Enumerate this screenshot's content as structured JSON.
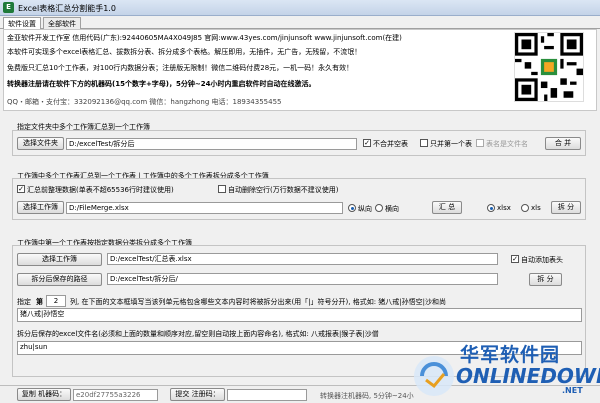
{
  "window": {
    "title": "Excel表格汇总分割能手1.0"
  },
  "tabs": [
    {
      "label": "软件设置",
      "active": true
    },
    {
      "label": "全部软件",
      "active": false
    }
  ],
  "info": {
    "line1": "金亚软件开发工作室 信用代码(广东):92440605MA4X049J85 官网:www.43yes.com/jinjunsoft  www.jinjunsoft.com(在建)",
    "line2": "本软件可实现多个excel表格汇总、拔数拆分表、拆分成多个表格。解压即用，无插件，无广告，无残留，不流氓！",
    "line3": "免费版只汇总10个工作表，对100行内数据分表；注册版无限制！微信二维码付费28元，一机一码！永久有效！",
    "line4": "转换器注册请在软件下方的机器码(15个数字+字母)，5分钟~24小时内重启软件时自动在线激活。",
    "line5": "QQ・邮箱・支付宝：332092136@qq.com     微信：hangzhong     电话：18934355455"
  },
  "section1": {
    "title": "指定文件夹中多个工作簿汇总到一个工作簿",
    "select_label": "选择文件夹",
    "path": "D:/excelTest/拆分后",
    "opt_no_merge": "不合并空表",
    "opt_no_merge_checked": true,
    "opt_first_only": "只并第一个表",
    "opt_first_only_checked": false,
    "opt_sheetname": "表名是文件名",
    "merge_label": "合 并"
  },
  "section2": {
    "title": "工作簿中多个工作表汇总到一个工作表 | 工作簿中的多个工作表拆分成多个工作簿",
    "opt_dedup": "汇总前整理数据(单表不超65536行时建议使用)",
    "opt_dedup_checked": true,
    "opt_delete_blank": "自动删除空行(万行数据不建议使用)",
    "opt_delete_blank_checked": false,
    "select_label": "选择工作簿",
    "path": "D:/FileMerge.xlsx",
    "radio_vertical": "纵向",
    "radio_horizontal": "横向",
    "sum_label": "汇 总",
    "radio_xlsx": "xlsx",
    "radio_xls": "xls",
    "split_label": "拆 分"
  },
  "section3": {
    "title": "工作簿中第一个工作表按指定数据分类拆分成多个工作簿",
    "select_label": "选择工作簿",
    "path1": "D:/excelTest/汇总表.xlsx",
    "opt_autohead": "自动添加表头",
    "opt_autohead_checked": true,
    "save_path_label": "拆分后保存的路径",
    "path2": "D:/excelTest/拆分后/",
    "split_label": "拆 分",
    "spec_prefix": "指定",
    "spec_column": "第",
    "spec_col_val": "2",
    "spec_after": "列, 在下面的文本框填写当该列单元格包含哪些文本内容时将被拆分出来(用「|」符号分开), 格式如: 猪八戒|孙悟空|沙和尚",
    "textarea1": "猪八戒|孙悟空",
    "filename_label": "拆分后保存的excel文件名(必须和上面的数量和顺序对应,留空则自动按上面内容命名), 格式如: 八戒报表|猴子表|沙僧",
    "textarea2": "zhu|sun"
  },
  "statusbar": {
    "copy_label": "复制 机器码：",
    "machine_code": "e20df27755a3226",
    "submit_label": "提交 注册码：",
    "reg_code": "",
    "hint": "转换器注机器码, 5分钟~24小"
  },
  "watermark": {
    "cn": "华军软件园",
    "en": "ONLINEDOWN",
    "suffix": ".NET"
  }
}
